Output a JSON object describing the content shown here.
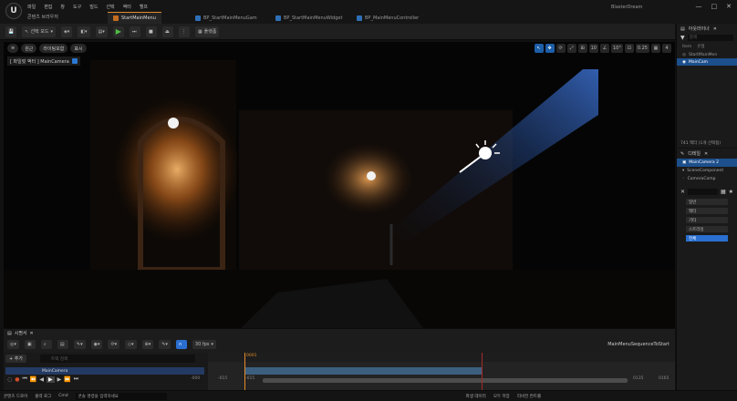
{
  "app": {
    "project_label": "콘텐츠 브라우저",
    "project_name": "BlasterDream",
    "menu": [
      "파일",
      "편집",
      "창",
      "도구",
      "빌드",
      "선택",
      "액터",
      "헬프"
    ],
    "window_controls": [
      "—",
      "□",
      "✕"
    ]
  },
  "tabs": [
    {
      "label": "StartMainMenu",
      "active": true
    },
    {
      "label": "BP_StartMainMenuGam",
      "active": false
    },
    {
      "label": "BP_StartMainMenuWidget",
      "active": false
    },
    {
      "label": "BP_MainMenuController",
      "active": false
    }
  ],
  "toolbar": {
    "save": "💾",
    "mode": "선택 모드",
    "platforms": "플랫폼",
    "settings": "세팅"
  },
  "viewport": {
    "left_pills": [
      "원근",
      "라이팅포함",
      "표시"
    ],
    "camera_label": "[ 파일럿 액터 ] MainCamera",
    "right_buttons": [
      "↖",
      "✥",
      "⟳",
      "⤢",
      "⊞",
      "10",
      "∠",
      "10°",
      "⊡",
      "0.25",
      "▦",
      "4"
    ],
    "light_color": "#e38b2c",
    "beam_color": "#3d74d8"
  },
  "outliner": {
    "title": "아웃라이너",
    "search_placeholder": "검색",
    "column_item": "Item",
    "column_type": "유형",
    "header_label": "StartMainMen",
    "rows": [
      {
        "label": "StartMainMen",
        "selected": false
      },
      {
        "label": "MainCam",
        "selected": true
      },
      {
        "label": "",
        "selected": false
      },
      {
        "label": "",
        "selected": false
      },
      {
        "label": "",
        "selected": false
      },
      {
        "label": "",
        "selected": false
      }
    ],
    "footer": "741 액터 (1개 선택됨)"
  },
  "details": {
    "title": "디테일",
    "selected_actor": "MainCamera 2",
    "components": [
      "SceneComponent",
      "CameraComp"
    ],
    "tabs": [
      "일반",
      "액터",
      "기타",
      "스트리밍",
      "전체"
    ],
    "active_tab": "전체"
  },
  "sequencer": {
    "tab_label": "시퀀서",
    "fps": "30 fps",
    "sequence_name": "MainMenuSequenceToStart",
    "track_add": "+ 추가",
    "search_placeholder": "트랙 검색",
    "track_name": "MainCamera",
    "playhead_frame": "0001",
    "frame_numbers": [
      "-000",
      "-015",
      "-015",
      "0135",
      "0165",
      "-0015"
    ],
    "end_frame": "0165"
  },
  "statusbar": {
    "content_drawer": "콘텐츠 드로어",
    "output_log": "출력 로그",
    "cmd": "Cmd",
    "cmd_placeholder": "콘솔 명령을 입력하세요",
    "derived_data": "파생 데이터",
    "saved": "모두 저장",
    "revision": "리비전 컨트롤"
  }
}
